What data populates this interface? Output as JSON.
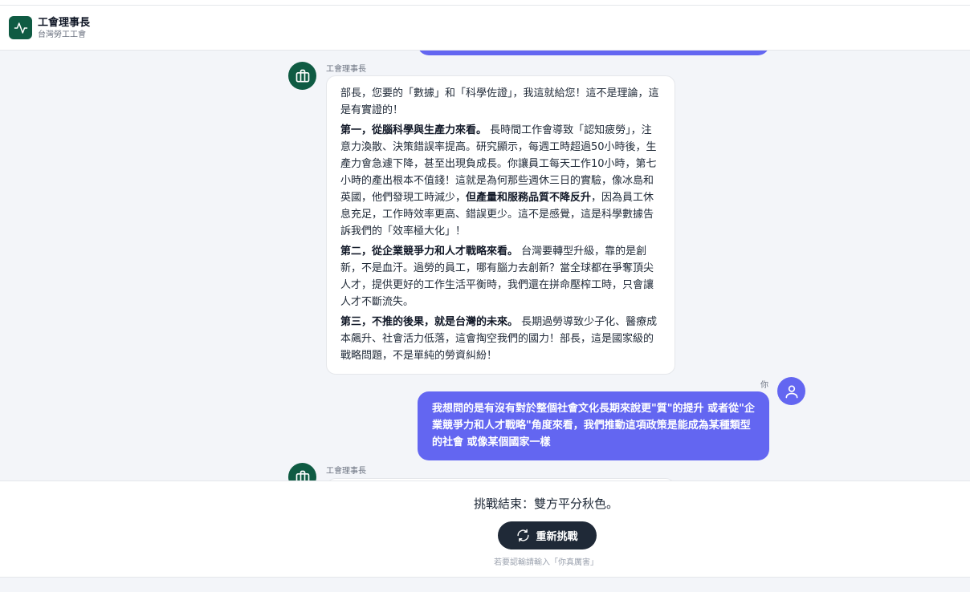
{
  "header": {
    "title": "工會理事長",
    "subtitle": "台灣勞工工會",
    "logo_icon": "activity-icon"
  },
  "messages": [
    {
      "role": "bot",
      "name": "工會理事長",
      "paragraphs": [
        {
          "bold": "",
          "text": "部長，您要的「數據」和「科學佐證」，我這就給您！這不是理論，這是有實證的！"
        },
        {
          "bold": "第一，從腦科學與生產力來看。",
          "text": "長時間工作會導致「認知疲勞」，注意力渙散、決策錯誤率提高。研究顯示，每週工時超過50小時後，生產力會急遽下降，甚至出現負成長。你讓員工每天工作10小時，第七小時的產出根本不值錢！這就是為何那些週休三日的實驗，像冰島和英國，他們發現工時減少，",
          "bold2": "但產量和服務品質不降反升",
          "text2": "，因為員工休息充足，工作時效率更高、錯誤更少。這不是感覺，這是科學數據告訴我們的「效率極大化」！"
        },
        {
          "bold": "第二，從企業競爭力和人才戰略來看。",
          "text": "台灣要轉型升級，靠的是創新，不是血汗。過勞的員工，哪有腦力去創新？當全球都在爭奪頂尖人才，提供更好的工作生活平衡時，我們還在拼命壓榨工時，只會讓人才不斷流失。"
        },
        {
          "bold": "第三，不推的後果，就是台灣的未來。",
          "text": "長期過勞導致少子化、醫療成本飆升、社會活力低落，這會掏空我們的國力！部長，這是國家級的戰略問題，不是單純的勞資糾紛！"
        }
      ]
    },
    {
      "role": "user",
      "name": "你",
      "text": "我想問的是有沒有對於整個社會文化長期來說更\"質\"的提升 或者從\"企業競爭力和人才戰略\"角度來看，我們推動這項政策是能成為某種類型的社會 或像某個國家一樣"
    },
    {
      "role": "bot",
      "name": "工會理事長"
    }
  ],
  "footer": {
    "end_text": "挑戰結束：雙方平分秋色。",
    "retry_label": "重新挑戰",
    "retry_icon": "refresh-icon",
    "hint": "若要認輸請輸入「你真厲害」"
  },
  "colors": {
    "brand": "#0f5b43",
    "user_bubble": "#6366f1",
    "button": "#1f2937"
  }
}
